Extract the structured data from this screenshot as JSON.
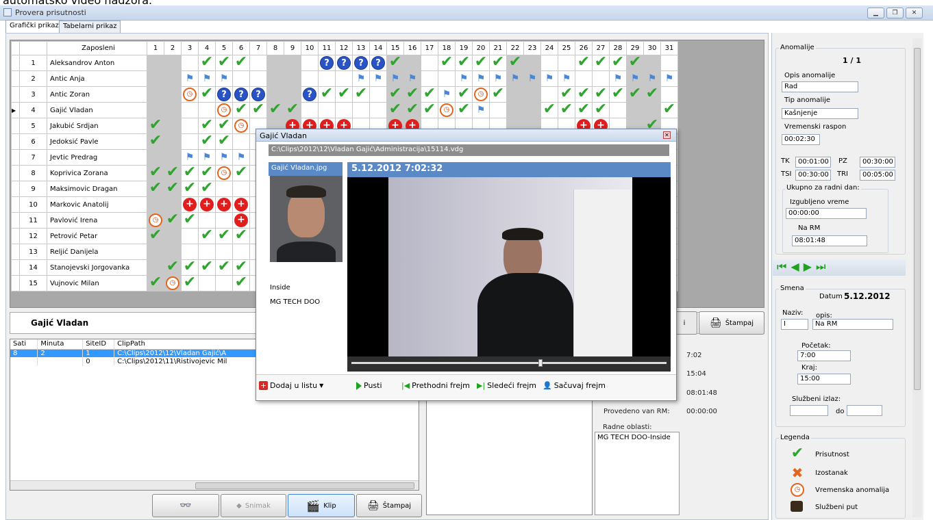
{
  "top_caption": "automatsko video nadzora.",
  "window": {
    "title": "Provera prisutnosti"
  },
  "tabs": [
    {
      "label": "Grafički prikaz"
    },
    {
      "label": "Tabelarni prikaz"
    }
  ],
  "grid": {
    "header_name": "Zaposleni",
    "days": [
      "1",
      "2",
      "3",
      "4",
      "5",
      "6",
      "7",
      "8",
      "9",
      "10",
      "11",
      "12",
      "13",
      "14",
      "15",
      "16",
      "17",
      "18",
      "19",
      "20",
      "21",
      "22",
      "23",
      "24",
      "25",
      "26",
      "27",
      "28",
      "29",
      "30",
      "31"
    ],
    "rows": [
      {
        "num": "1",
        "name": "Aleksandrov Anton",
        "cells": "",
        "marks": "__.OOO____QQQQO__OOOOO___OOOO__AOOA"
      },
      {
        "num": "2",
        "name": "Antic Anja",
        "marks": "..FFF_______FFFF__FFFFFFF__FFFFFF_F"
      },
      {
        "num": "3",
        "name": "Antic Zoran",
        "marks": "..AOQQQ__QOOO_OOOFOAO___OOOOOO_"
      },
      {
        "num": "4",
        "name": "Gajić Vladan",
        "marks": "....AOOOO_____OOOAOF___OOOO___OOO"
      },
      {
        "num": "5",
        "name": "Jakubić Srdjan",
        "marks": "O_.OOA__SSSS__SS_________SS__O"
      },
      {
        "num": "6",
        "name": "Jedoksić Pavle",
        "marks": "O_.OO"
      },
      {
        "num": "7",
        "name": "Jevtic Predrag",
        "marks": "__FFFF"
      },
      {
        "num": "8",
        "name": "Koprivica Zorana",
        "marks": "OOOOAO"
      },
      {
        "num": "9",
        "name": "Maksimovic Dragan",
        "marks": "OOOO"
      },
      {
        "num": "10",
        "name": "Markovic Anatolij",
        "marks": "__SSSS"
      },
      {
        "num": "11",
        "name": "Pavlović Irena",
        "marks": "AOO__S"
      },
      {
        "num": "12",
        "name": "Petrović Petar",
        "marks": "O__OOO"
      },
      {
        "num": "13",
        "name": "Reljić Danijela",
        "marks": ""
      },
      {
        "num": "14",
        "name": "Stanojevski Jorgovanka",
        "marks": "_OOOOO"
      },
      {
        "num": "15",
        "name": "Vujnovic Milan",
        "marks": "OAO__O"
      }
    ]
  },
  "selected_employee": "Gajić Vladan",
  "buttons": {
    "snimak": "Snimak",
    "klip": "Klip",
    "stampaj": "Štampaj",
    "stampaj2": "Štampaj"
  },
  "clips": {
    "headers": [
      "Sati",
      "Minuta",
      "SiteID",
      "ClipPath"
    ],
    "rows": [
      [
        "8",
        "2",
        "1",
        "C:\\Clips\\2012\\12\\Vladan Gajić\\A"
      ],
      [
        "",
        "",
        "0",
        "C:\\Clips\\2012\\11\\Ristivojevic Mil"
      ]
    ]
  },
  "info": {
    "v1": "7:02",
    "v2": "15:04",
    "v3": "08:01:48",
    "provedeno_label": "Provedeno van RM:",
    "provedeno_value": "00:00:00",
    "radne_label": "Radne oblasti:",
    "radne_value": "MG TECH DOO-Inside"
  },
  "anomalije": {
    "title": "Anomalije",
    "counter": "1  /  1",
    "opis_label": "Opis anomalije",
    "opis_value": "Rad",
    "tip_label": "Tip anomalije",
    "tip_value": "Kašnjenje",
    "vreme_label": "Vremenski raspon",
    "vreme_value": "00:02:30",
    "tk_label": "TK",
    "tk_value": "00:01:00",
    "pz_label": "PZ",
    "pz_value": "00:30:00",
    "tsi_label": "TSI",
    "tsi_value": "00:30:00",
    "tri_label": "TRI",
    "tri_value": "00:05:00",
    "ukupno_label": "Ukupno za radni dan:",
    "izgub_label": "Izgubljeno vreme",
    "izgub_value": "00:00:00",
    "narm_label": "Na RM",
    "narm_value": "08:01:48"
  },
  "smena": {
    "title": "Smena",
    "datum_label": "Datum",
    "datum_value": "5.12.2012",
    "naziv_label": "Naziv:",
    "naziv_value": "I",
    "opis_label": "opis:",
    "opis_value": "Na RM",
    "pocetak_label": "Početak:",
    "pocetak_value": "7:00",
    "kraj_label": "Kraj:",
    "kraj_value": "15:00",
    "sluzbeni_label": "Službeni izlaz:",
    "do_label": "do"
  },
  "legenda": {
    "title": "Legenda",
    "items": [
      "Prisutnost",
      "Izostanak",
      "Vremenska anomalija",
      "Službeni put"
    ]
  },
  "popup": {
    "title": "Gajić Vladan",
    "path": "C:\\Clips\\2012\\12\\Vladan Gajić\\Administracija\\15114.vdg",
    "thumb_label": "Gajić Vladan.jpg",
    "timestamp": "5.12.2012 7:02:32",
    "inside": "Inside",
    "company": "MG TECH DOO",
    "tools": {
      "dodaj": "Dodaj u listu",
      "pusti": "Pusti",
      "prethodni": "Prethodni frejm",
      "sledeci": "Sledeći frejm",
      "sacuvaj": "Sačuvaj frejm"
    }
  },
  "colors": {
    "check": "#2fa42f",
    "question": "#2a54c4",
    "anomaly": "#e2651d",
    "flag": "#4a86d6",
    "sick": "#e01e1e",
    "selected_row": "#3399ff"
  }
}
